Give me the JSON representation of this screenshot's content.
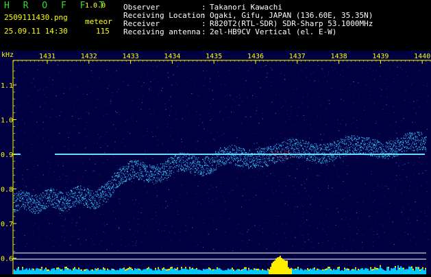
{
  "header": {
    "app_name": "H R O F F T",
    "app_version": "1.0.0",
    "filename": "2509111430.png",
    "datetime": "25.09.11 14:30",
    "meteor_label": "meteor",
    "meteor_count": "115",
    "info": [
      {
        "label": "Observer",
        "colon": ":",
        "value": "Takanori Kawachi"
      },
      {
        "label": "Receiving Location",
        "colon": ":",
        "value": "Ogaki, Gifu, JAPAN (136.60E, 35.35N)"
      },
      {
        "label": "Receiver",
        "colon": ":",
        "value": "R820T2(RTL-SDR) SDR-Sharp 53.1000MHz"
      },
      {
        "label": "Receiving antenna",
        "colon": ":",
        "value": "2el-HB9CV Vertical (el. E-W)"
      }
    ]
  },
  "spectrogram": {
    "y_unit": "kHz",
    "y_ticks": [
      "1.1",
      "1.0",
      "0.9",
      "0.8",
      "0.7",
      "0.6"
    ],
    "time_ticks": [
      "1431",
      "1432",
      "1433",
      "1434",
      "1435",
      "1436",
      "1437",
      "1438",
      "1439",
      "1440"
    ],
    "colors": {
      "background": "#000040",
      "noise": "#1a3fd0",
      "signal": "#33ccff",
      "hot": "#ff4040",
      "axis": "#ffff00",
      "power_bar": "#00c8ff"
    }
  }
}
